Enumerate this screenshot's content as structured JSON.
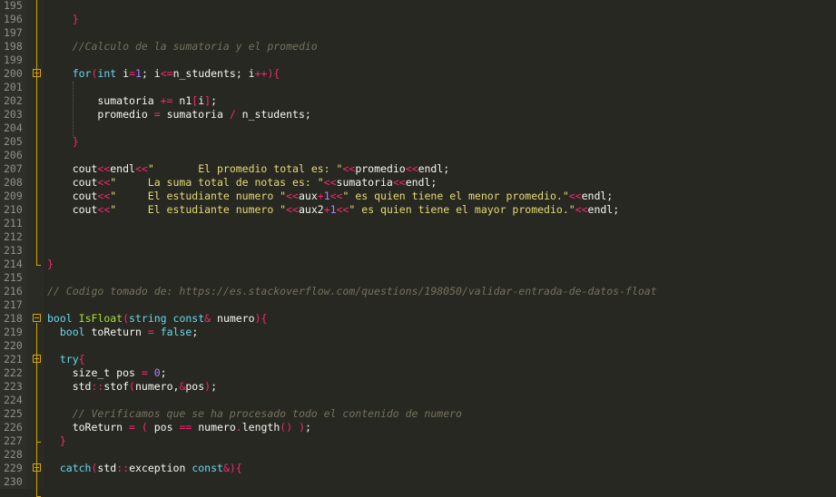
{
  "editor": {
    "language": "C++",
    "theme_colors": {
      "background": "#272822",
      "gutter": "#2f2f2a",
      "keyword": "#66d9ef",
      "operator": "#f92672",
      "number": "#ae81ff",
      "string": "#e6db74",
      "comment": "#75715e",
      "fold_marker": "#d7a500"
    },
    "lines": [
      {
        "n": "195",
        "tokens": []
      },
      {
        "n": "196",
        "tokens": [
          [
            "pl",
            "    "
          ],
          [
            "br",
            "}"
          ]
        ]
      },
      {
        "n": "197",
        "tokens": []
      },
      {
        "n": "198",
        "tokens": [
          [
            "pl",
            "    "
          ],
          [
            "cm",
            "//Calculo de la sumatoria y el promedio"
          ]
        ]
      },
      {
        "n": "199",
        "tokens": []
      },
      {
        "n": "200",
        "fold": "open",
        "tokens": [
          [
            "pl",
            "    "
          ],
          [
            "kw",
            "for"
          ],
          [
            "br",
            "("
          ],
          [
            "kw",
            "int"
          ],
          [
            "pl",
            " i"
          ],
          [
            "op",
            "="
          ],
          [
            "num",
            "1"
          ],
          [
            "pl",
            "; i"
          ],
          [
            "op",
            "<="
          ],
          [
            "pl",
            "n_students; i"
          ],
          [
            "op",
            "++"
          ],
          [
            "br",
            ")"
          ],
          [
            "br",
            "{"
          ]
        ]
      },
      {
        "n": "201",
        "tokens": []
      },
      {
        "n": "202",
        "tokens": [
          [
            "pl",
            "        sumatoria "
          ],
          [
            "op",
            "+="
          ],
          [
            "pl",
            " n1"
          ],
          [
            "br",
            "["
          ],
          [
            "pl",
            "i"
          ],
          [
            "br",
            "]"
          ],
          [
            "pl",
            ";"
          ]
        ]
      },
      {
        "n": "203",
        "tokens": [
          [
            "pl",
            "        promedio "
          ],
          [
            "op",
            "="
          ],
          [
            "pl",
            " sumatoria "
          ],
          [
            "op",
            "/"
          ],
          [
            "pl",
            " n_students;"
          ]
        ]
      },
      {
        "n": "204",
        "tokens": []
      },
      {
        "n": "205",
        "tokens": [
          [
            "pl",
            "    "
          ],
          [
            "br",
            "}"
          ]
        ]
      },
      {
        "n": "206",
        "tokens": []
      },
      {
        "n": "207",
        "tokens": [
          [
            "pl",
            "    cout"
          ],
          [
            "op",
            "<<"
          ],
          [
            "pl",
            "endl"
          ],
          [
            "op",
            "<<"
          ],
          [
            "str",
            "\"       El promedio total es: \""
          ],
          [
            "op",
            "<<"
          ],
          [
            "pl",
            "promedio"
          ],
          [
            "op",
            "<<"
          ],
          [
            "pl",
            "endl;"
          ]
        ]
      },
      {
        "n": "208",
        "tokens": [
          [
            "pl",
            "    cout"
          ],
          [
            "op",
            "<<"
          ],
          [
            "str",
            "\"     La suma total de notas es: \""
          ],
          [
            "op",
            "<<"
          ],
          [
            "pl",
            "sumatoria"
          ],
          [
            "op",
            "<<"
          ],
          [
            "pl",
            "endl;"
          ]
        ]
      },
      {
        "n": "209",
        "tokens": [
          [
            "pl",
            "    cout"
          ],
          [
            "op",
            "<<"
          ],
          [
            "str",
            "\"     El estudiante numero \""
          ],
          [
            "op",
            "<<"
          ],
          [
            "pl",
            "aux"
          ],
          [
            "op",
            "+"
          ],
          [
            "num",
            "1"
          ],
          [
            "op",
            "<<"
          ],
          [
            "str",
            "\" es quien tiene el menor promedio.\""
          ],
          [
            "op",
            "<<"
          ],
          [
            "pl",
            "endl;"
          ]
        ]
      },
      {
        "n": "210",
        "tokens": [
          [
            "pl",
            "    cout"
          ],
          [
            "op",
            "<<"
          ],
          [
            "str",
            "\"     El estudiante numero \""
          ],
          [
            "op",
            "<<"
          ],
          [
            "pl",
            "aux2"
          ],
          [
            "op",
            "+"
          ],
          [
            "num",
            "1"
          ],
          [
            "op",
            "<<"
          ],
          [
            "str",
            "\" es quien tiene el mayor promedio.\""
          ],
          [
            "op",
            "<<"
          ],
          [
            "pl",
            "endl;"
          ]
        ]
      },
      {
        "n": "211",
        "tokens": []
      },
      {
        "n": "212",
        "tokens": []
      },
      {
        "n": "213",
        "tokens": []
      },
      {
        "n": "214",
        "fold": "end",
        "tokens": [
          [
            "br",
            "}"
          ]
        ]
      },
      {
        "n": "215",
        "tokens": []
      },
      {
        "n": "216",
        "tokens": [
          [
            "cm",
            "// Codigo tomado de: https://es.stackoverflow.com/questions/198050/validar-entrada-de-datos-float"
          ]
        ]
      },
      {
        "n": "217",
        "tokens": []
      },
      {
        "n": "218",
        "fold": "open",
        "tokens": [
          [
            "kw",
            "bool"
          ],
          [
            "pl",
            " "
          ],
          [
            "fn",
            "IsFloat"
          ],
          [
            "br",
            "("
          ],
          [
            "kw",
            "string"
          ],
          [
            "pl",
            " "
          ],
          [
            "kw",
            "const"
          ],
          [
            "op",
            "&"
          ],
          [
            "pl",
            " numero"
          ],
          [
            "br",
            ")"
          ],
          [
            "br",
            "{"
          ]
        ]
      },
      {
        "n": "219",
        "tokens": [
          [
            "pl",
            "  "
          ],
          [
            "kw",
            "bool"
          ],
          [
            "pl",
            " toReturn "
          ],
          [
            "op",
            "="
          ],
          [
            "pl",
            " "
          ],
          [
            "kw",
            "false"
          ],
          [
            "pl",
            ";"
          ]
        ]
      },
      {
        "n": "220",
        "tokens": []
      },
      {
        "n": "221",
        "fold": "open",
        "tokens": [
          [
            "pl",
            "  "
          ],
          [
            "kw",
            "try"
          ],
          [
            "br",
            "{"
          ]
        ]
      },
      {
        "n": "222",
        "tokens": [
          [
            "pl",
            "    size_t pos "
          ],
          [
            "op",
            "="
          ],
          [
            "pl",
            " "
          ],
          [
            "num",
            "0"
          ],
          [
            "pl",
            ";"
          ]
        ]
      },
      {
        "n": "223",
        "tokens": [
          [
            "pl",
            "    std"
          ],
          [
            "op",
            "::"
          ],
          [
            "pl",
            "stof"
          ],
          [
            "br",
            "("
          ],
          [
            "pl",
            "numero,"
          ],
          [
            "op",
            "&"
          ],
          [
            "pl",
            "pos"
          ],
          [
            "br",
            ")"
          ],
          [
            "pl",
            ";"
          ]
        ]
      },
      {
        "n": "224",
        "tokens": []
      },
      {
        "n": "225",
        "tokens": [
          [
            "pl",
            "    "
          ],
          [
            "cm",
            "// Verificamos que se ha procesado todo el contenido de numero"
          ]
        ]
      },
      {
        "n": "226",
        "tokens": [
          [
            "pl",
            "    toReturn "
          ],
          [
            "op",
            "="
          ],
          [
            "pl",
            " "
          ],
          [
            "br",
            "("
          ],
          [
            "pl",
            " pos "
          ],
          [
            "op",
            "=="
          ],
          [
            "pl",
            " numero"
          ],
          [
            "op",
            "."
          ],
          [
            "pl",
            "length"
          ],
          [
            "br",
            "()"
          ],
          [
            "pl",
            " "
          ],
          [
            "br",
            ")"
          ],
          [
            "pl",
            ";"
          ]
        ]
      },
      {
        "n": "227",
        "fold": "end",
        "tokens": [
          [
            "pl",
            "  "
          ],
          [
            "br",
            "}"
          ]
        ]
      },
      {
        "n": "228",
        "tokens": []
      },
      {
        "n": "229",
        "fold": "open",
        "tokens": [
          [
            "pl",
            "  "
          ],
          [
            "kw",
            "catch"
          ],
          [
            "br",
            "("
          ],
          [
            "pl",
            "std"
          ],
          [
            "op",
            "::"
          ],
          [
            "pl",
            "exception "
          ],
          [
            "kw",
            "const"
          ],
          [
            "op",
            "&"
          ],
          [
            "br",
            ")"
          ],
          [
            "br",
            "{"
          ]
        ]
      },
      {
        "n": "230",
        "tokens": []
      }
    ]
  }
}
